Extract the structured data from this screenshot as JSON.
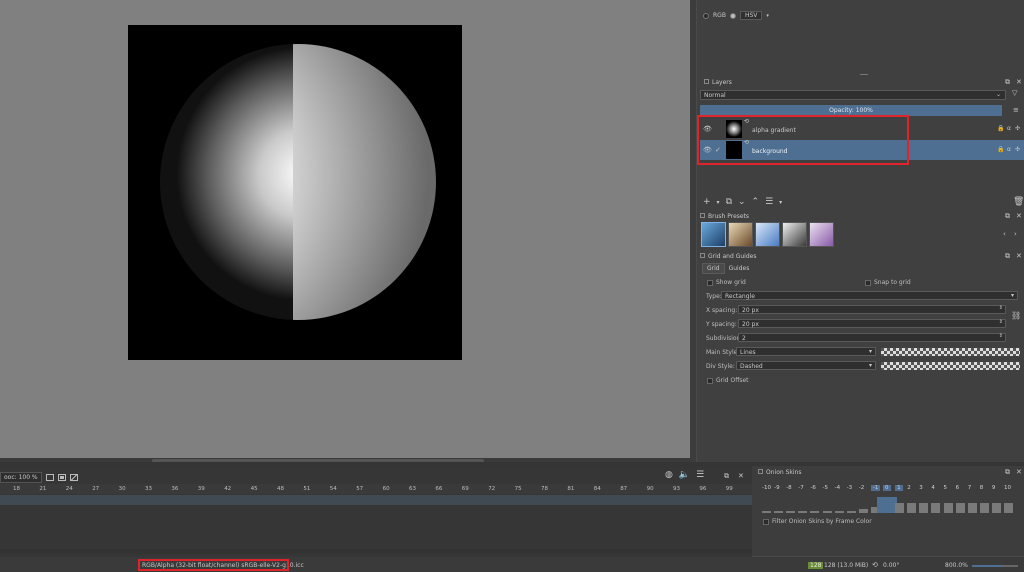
{
  "color_selector": {
    "mode1": "RGB",
    "mode2": "HSV"
  },
  "layers": {
    "title": "Layers",
    "blend_mode": "Normal",
    "opacity_label": "Opacity:  100%",
    "items": [
      {
        "name": "alpha gradient",
        "selected": false,
        "checked": false
      },
      {
        "name": "background",
        "selected": true,
        "checked": true
      }
    ]
  },
  "brush_presets": {
    "title": "Brush Presets"
  },
  "grid": {
    "title": "Grid and Guides",
    "tabs": [
      "Grid",
      "Guides"
    ],
    "show_grid": "Show grid",
    "snap_to_grid": "Snap to grid",
    "type_label": "Type:",
    "type_value": "Rectangle",
    "x_spacing_label": "X spacing:",
    "x_spacing_value": "20 px",
    "y_spacing_label": "Y spacing:",
    "y_spacing_value": "20 px",
    "subdivision_label": "Subdivision:",
    "subdivision_value": "2",
    "main_style_label": "Main Style:",
    "main_style_value": "Lines",
    "div_style_label": "Div Style:",
    "div_style_value": "Dashed",
    "grid_offset": "Grid Offset"
  },
  "timeline": {
    "zoom_label": "ooc: 100 %",
    "frames": [
      "18",
      "21",
      "24",
      "27",
      "30",
      "33",
      "36",
      "39",
      "42",
      "45",
      "48",
      "51",
      "54",
      "57",
      "60",
      "63",
      "66",
      "69",
      "72",
      "75",
      "78",
      "81",
      "84",
      "87",
      "90",
      "93",
      "96",
      "99"
    ]
  },
  "onion": {
    "title": "Onion Skins",
    "numbers": [
      "-10",
      "-9",
      "-8",
      "-7",
      "-6",
      "-5",
      "-4",
      "-3",
      "-2",
      "-1",
      "0",
      "1",
      "2",
      "3",
      "4",
      "5",
      "6",
      "7",
      "8",
      "9",
      "10"
    ],
    "filter_label": "Filter Onion Skins by Frame Color"
  },
  "status": {
    "color_space": "RGB/Alpha (32-bit float/channel)  sRGB-elle-V2-g10.icc",
    "memory_badge": "128",
    "memory_text": "128 (13.0 MiB)",
    "rotation": "0.00°",
    "zoom": "800.0%"
  },
  "colors": {
    "accent": "#4e6f92",
    "highlight_box": "#e0242b"
  }
}
